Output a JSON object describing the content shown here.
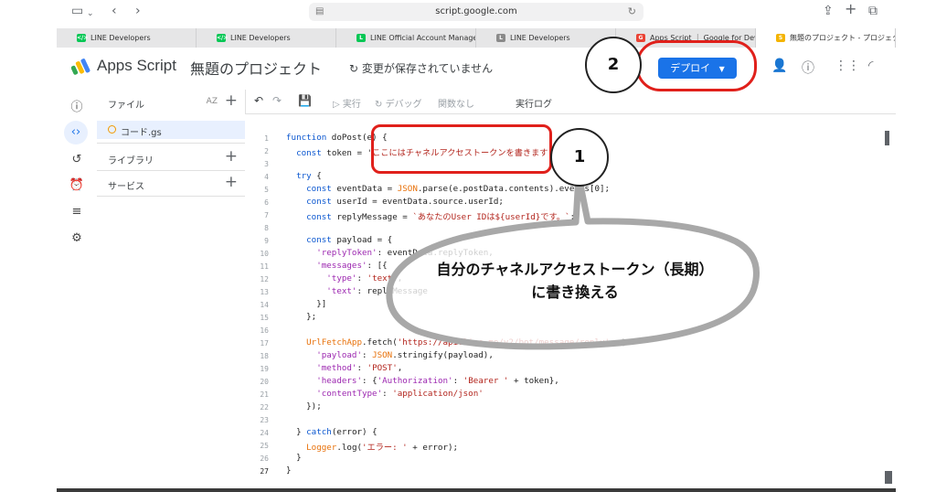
{
  "browser": {
    "url": "script.google.com",
    "tabs": [
      {
        "label": "LINE Developers",
        "favicon_color": "#06c755",
        "favicon_glyph": "</>"
      },
      {
        "label": "LINE Developers",
        "favicon_color": "#06c755",
        "favicon_glyph": "</>"
      },
      {
        "label": "LINE Official Account Manager",
        "favicon_color": "#06c755",
        "favicon_glyph": "L"
      },
      {
        "label": "LINE Developers",
        "favicon_color": "#8a8a8a",
        "favicon_glyph": "L"
      },
      {
        "label": "Apps Script ｜ Google for Dev...",
        "favicon_color": "#ea4335",
        "favicon_glyph": "G"
      },
      {
        "label": "無題のプロジェクト - プロジェク...",
        "favicon_color": "#f4b400",
        "favicon_glyph": "S"
      }
    ]
  },
  "app": {
    "brand": "Apps Script",
    "project_title": "無題のプロジェクト",
    "save_status": "変更が保存されていません",
    "deploy_label": "デプロイ",
    "accent_color": "#1a73e8"
  },
  "sidebar": {
    "files_label": "ファイル",
    "sort_label": "AZ",
    "file_name": "コード.gs",
    "library_label": "ライブラリ",
    "services_label": "サービス"
  },
  "rail_icons": [
    "info-icon",
    "code-icon",
    "history-icon",
    "trigger-icon",
    "executions-icon",
    "settings-icon"
  ],
  "toolbar": {
    "run_label": "実行",
    "debug_label": "デバッグ",
    "function_label": "関数なし",
    "log_label": "実行ログ"
  },
  "code": {
    "line_numbers": [
      "1",
      "2",
      "3",
      "4",
      "5",
      "6",
      "7",
      "8",
      "9",
      "10",
      "11",
      "12",
      "13",
      "14",
      "15",
      "16",
      "17",
      "18",
      "19",
      "20",
      "21",
      "22",
      "23",
      "24",
      "25",
      "26",
      "27"
    ],
    "token_placeholder": "ここにはチャネルアクセストークンを書きます"
  },
  "annotations": {
    "step1": "1",
    "step2": "2",
    "bubble_line1": "自分のチャネルアクセストークン（長期）",
    "bubble_line2": "に書き換える",
    "highlight_color": "#e0201b"
  }
}
